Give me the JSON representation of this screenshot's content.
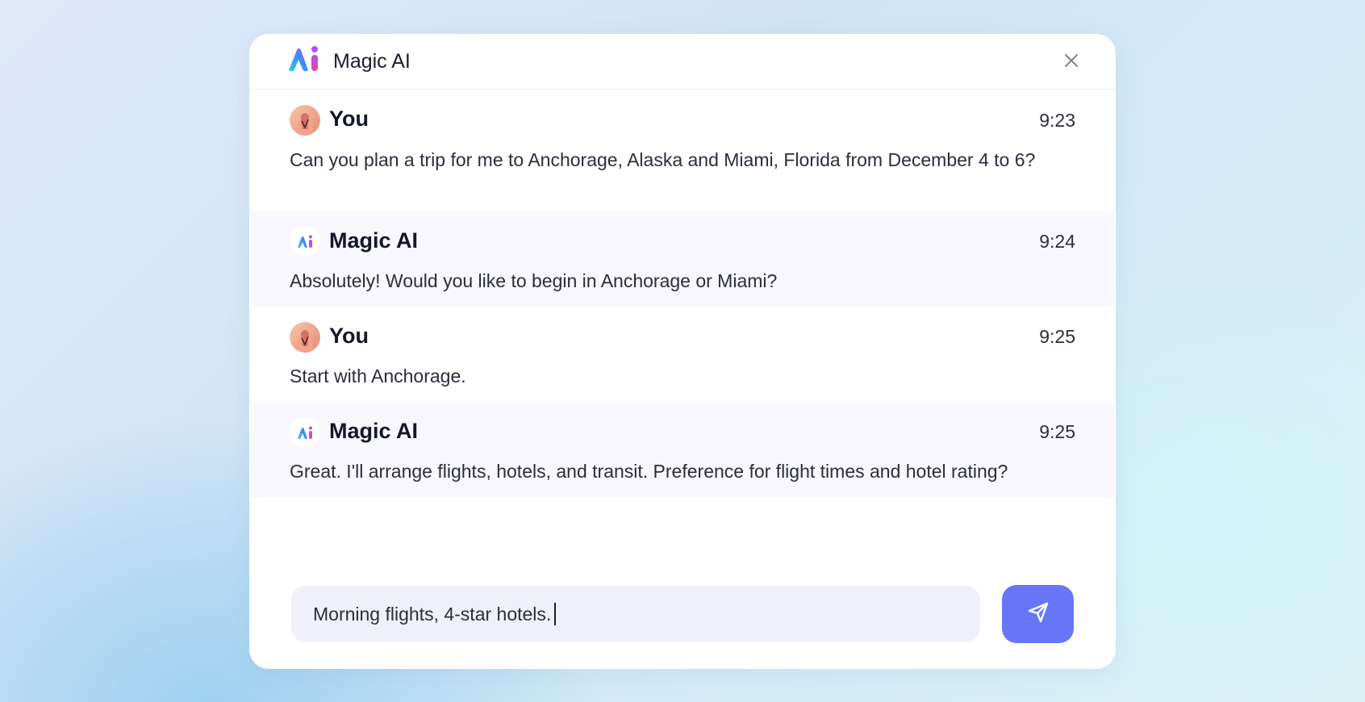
{
  "header": {
    "title": "Magic AI",
    "logo_icon": "magic-ai-logo-icon",
    "close_icon": "close-icon"
  },
  "messages": [
    {
      "author": "You",
      "role": "user",
      "time": "9:23",
      "text": "Can you plan a trip for me to Anchorage, Alaska and Miami, Florida from December 4 to 6?",
      "avatar_icon": "user-avatar"
    },
    {
      "author": "Magic AI",
      "role": "ai",
      "time": "9:24",
      "text": "Absolutely! Would you like to begin in Anchorage or Miami?",
      "avatar_icon": "magic-ai-avatar"
    },
    {
      "author": "You",
      "role": "user",
      "time": "9:25",
      "text": "Start with Anchorage.",
      "avatar_icon": "user-avatar"
    },
    {
      "author": "Magic AI",
      "role": "ai",
      "time": "9:25",
      "text": "Great. I'll arrange flights, hotels, and transit. Preference for flight times and hotel rating?",
      "avatar_icon": "magic-ai-avatar"
    }
  ],
  "composer": {
    "value": "Morning flights, 4-star hotels.",
    "send_icon": "send-icon"
  },
  "colors": {
    "accent": "#6676f7",
    "ai_message_bg": "#f7f7fd",
    "input_bg": "#eff0fa",
    "text": "#2b2d3c",
    "heading": "#14162a"
  }
}
